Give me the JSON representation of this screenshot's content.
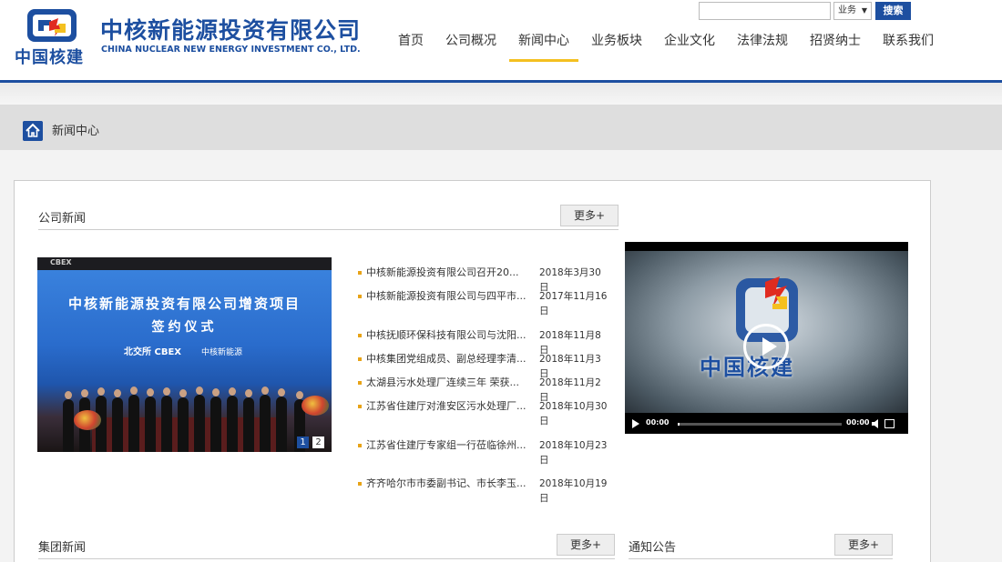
{
  "header": {
    "logo_brand": "中国核建",
    "company_cn": "中核新能源投资有限公司",
    "company_en": "CHINA NUCLEAR NEW ENERGY INVESTMENT CO., LTD.",
    "search": {
      "value": "",
      "placeholder": "",
      "select_value": "业务",
      "button_label": "搜索"
    },
    "nav": [
      {
        "label": "首页",
        "active": false
      },
      {
        "label": "公司概况",
        "active": false
      },
      {
        "label": "新闻中心",
        "active": true
      },
      {
        "label": "业务板块",
        "active": false
      },
      {
        "label": "企业文化",
        "active": false
      },
      {
        "label": "法律法规",
        "active": false
      },
      {
        "label": "招贤纳士",
        "active": false
      },
      {
        "label": "联系我们",
        "active": false
      }
    ],
    "accent_color": "#1d4fa0",
    "active_underline_color": "#f4c020"
  },
  "breadcrumb": {
    "icon": "home-icon",
    "label": "新闻中心"
  },
  "company_news": {
    "title": "公司新闻",
    "more_label": "更多+",
    "photo": {
      "top_text": "CBEX",
      "banner_line1": "中核新能源投资有限公司增资项目",
      "banner_line2": "签约仪式",
      "logo_a": "北交所 CBEX",
      "logo_b": "中核新能源",
      "pages": [
        "1",
        "2"
      ]
    },
    "items": [
      {
        "title": "中核新能源投资有限公司召开20...",
        "date": "2018年3月30日"
      },
      {
        "title": "中核新能源投资有限公司与四平市...",
        "date": "2017年11月16日"
      },
      {
        "title": "中核抚顺环保科技有限公司与沈阳...",
        "date": "2018年11月8日"
      },
      {
        "title": "中核集团党组成员、副总经理李清...",
        "date": "2018年11月3日"
      },
      {
        "title": "太湖县污水处理厂连续三年 荣获...",
        "date": "2018年11月2日"
      },
      {
        "title": "江苏省住建厅对淮安区污水处理厂...",
        "date": "2018年10月30日"
      },
      {
        "title": "江苏省住建厅专家组一行莅临徐州...",
        "date": "2018年10月23日"
      },
      {
        "title": "齐齐哈尔市市委副书记、市长李玉...",
        "date": "2018年10月19日"
      }
    ]
  },
  "video": {
    "brand": "中国核建",
    "time_current": "00:00",
    "time_total": "00:00",
    "progress": 0
  },
  "group_news": {
    "title": "集团新闻",
    "more_label": "更多+"
  },
  "notices": {
    "title": "通知公告",
    "more_label": "更多+"
  }
}
